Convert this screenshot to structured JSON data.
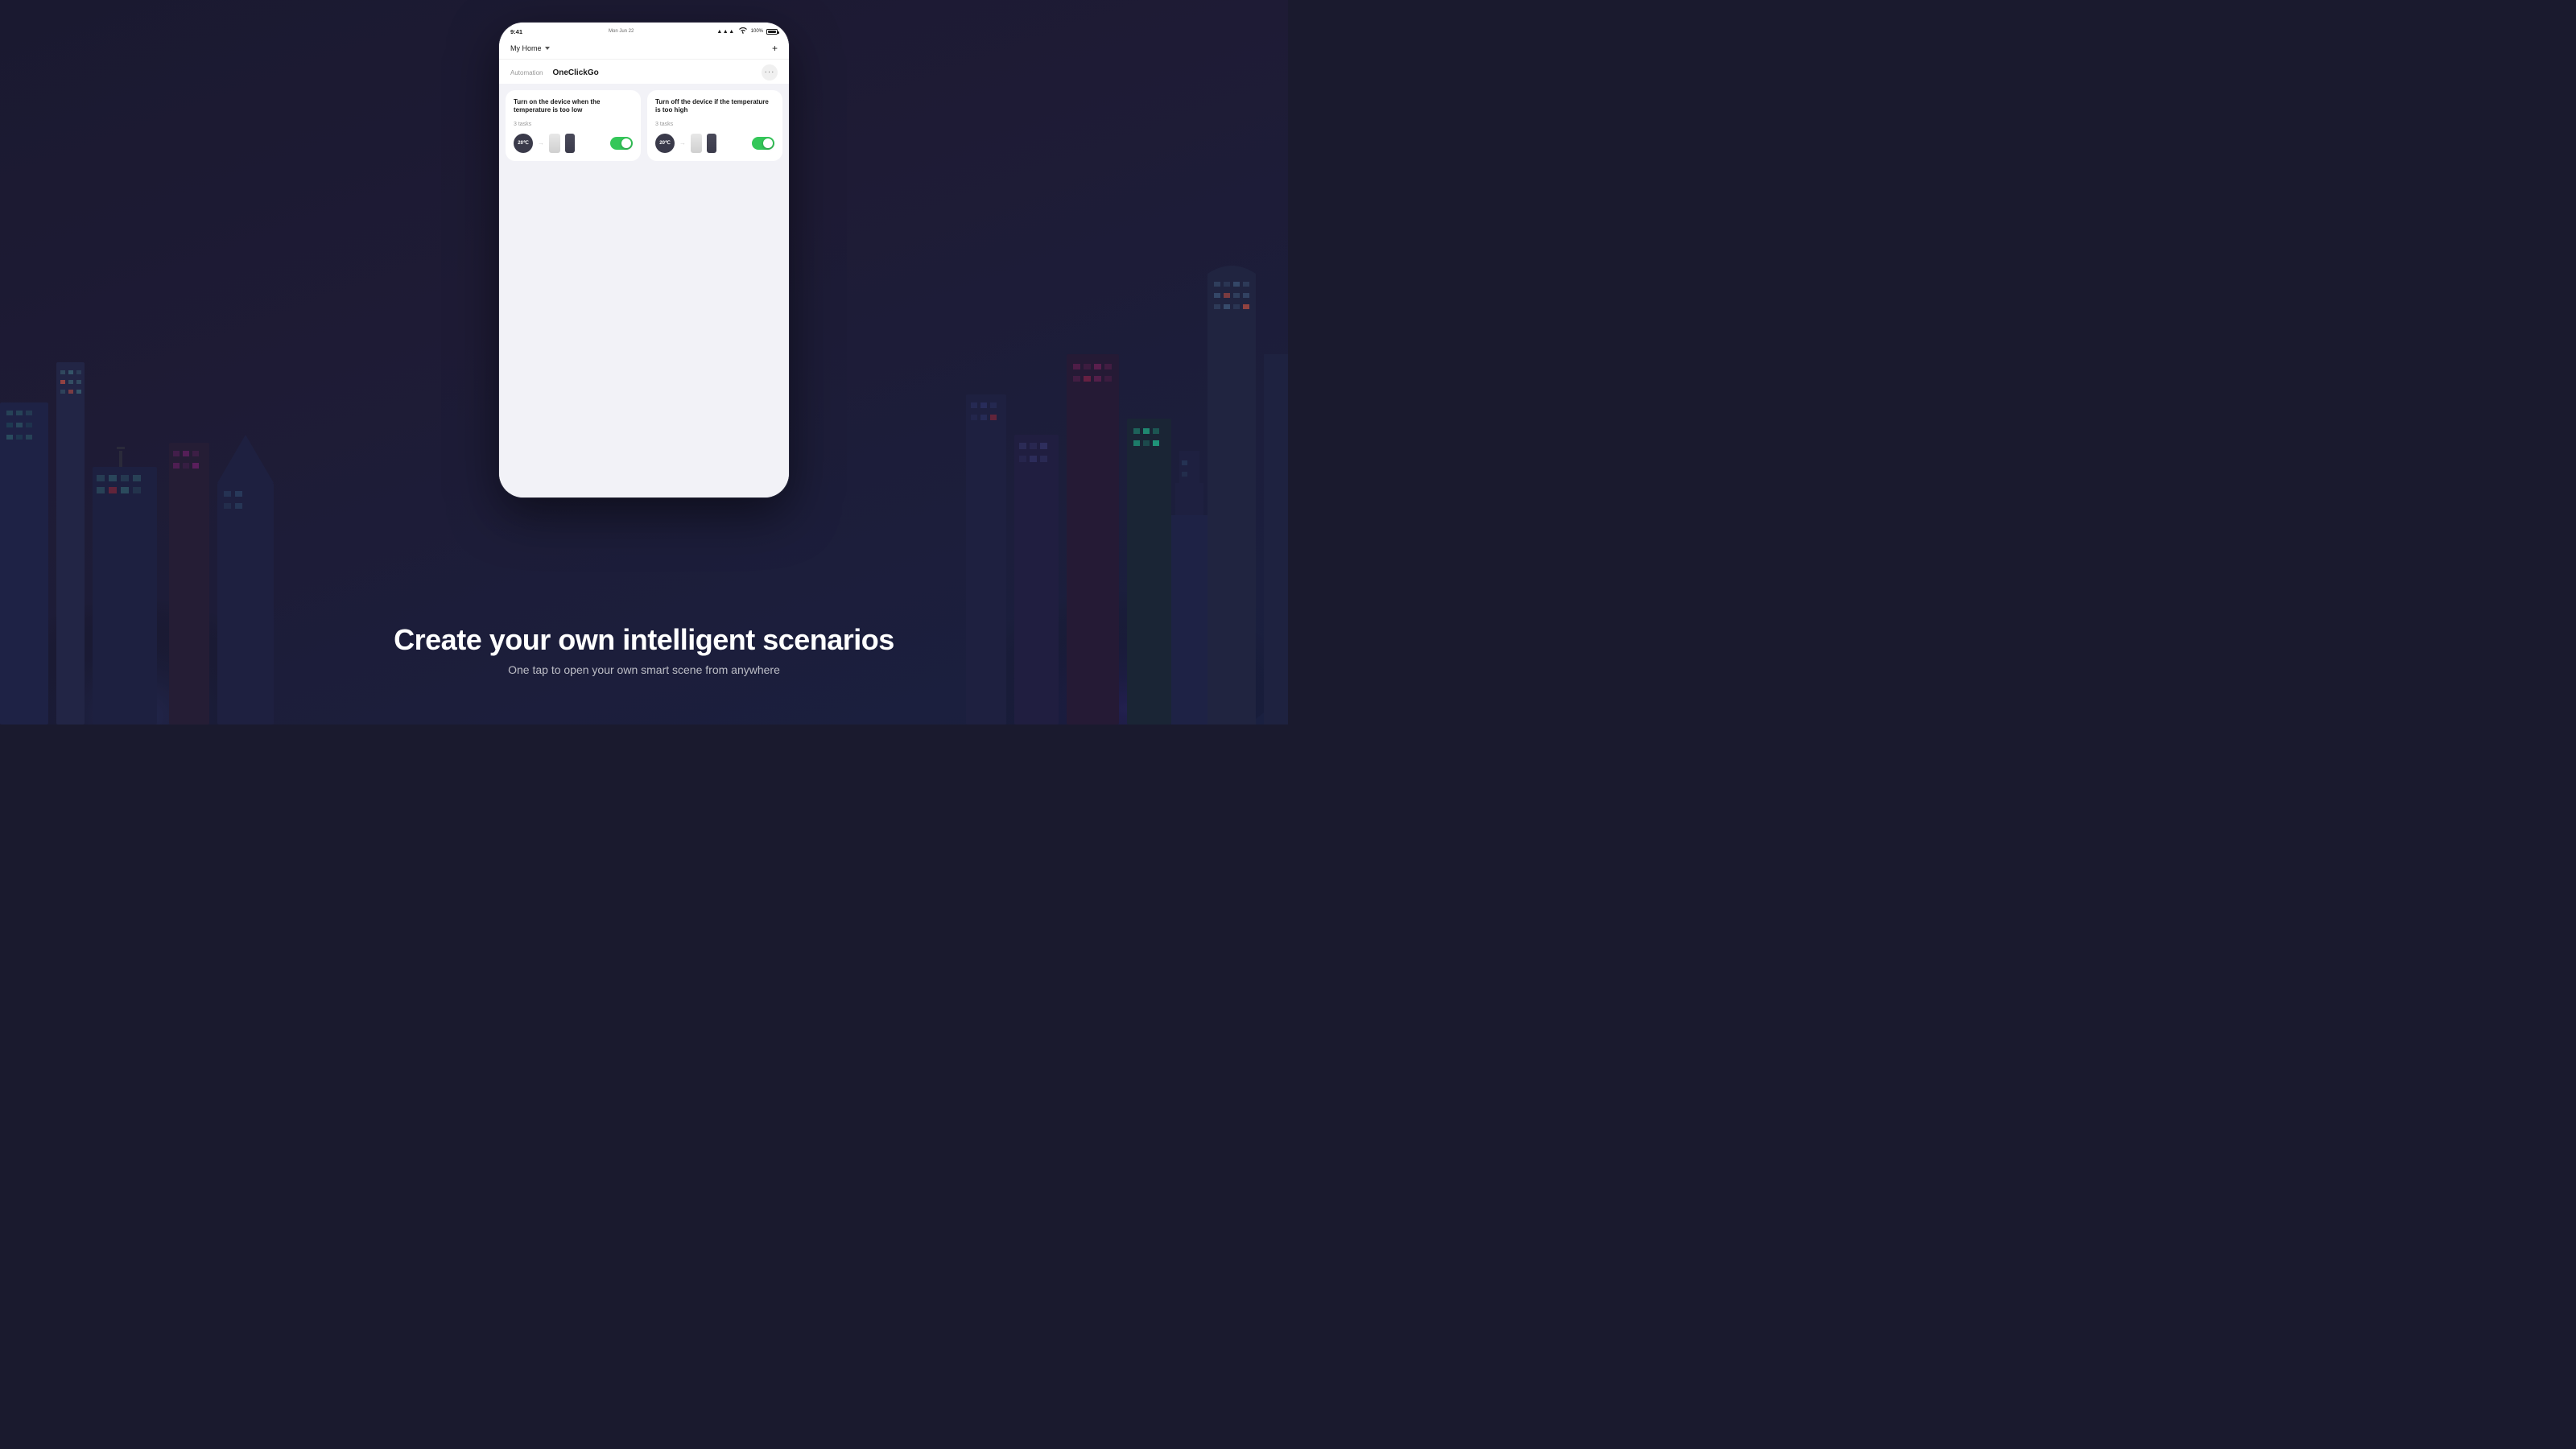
{
  "background": {
    "gradient_start": "#1a1930",
    "gradient_end": "#1a2040"
  },
  "status_bar": {
    "time": "9:41",
    "date": "Mon Jun 22",
    "battery": "100%",
    "signal": "▲▲▲",
    "wifi": "wifi"
  },
  "nav": {
    "home_title": "My Home",
    "plus_label": "+",
    "chevron": "▾"
  },
  "tabs": {
    "automation_label": "Automation",
    "oneclickgo_label": "OneClickGo",
    "more_dots": "···"
  },
  "automation_cards": [
    {
      "id": "card-1",
      "title": "Turn on the device when the temperature is too low",
      "tasks_label": "3 tasks",
      "temp_value": "20℃",
      "toggle_on": true
    },
    {
      "id": "card-2",
      "title": "Turn off the device if the temperature is too high",
      "tasks_label": "3 tasks",
      "temp_value": "20℃",
      "toggle_on": true
    }
  ],
  "footer": {
    "headline": "Create your own intelligent scenarios",
    "subheadline": "One tap to open your own smart scene from anywhere"
  }
}
